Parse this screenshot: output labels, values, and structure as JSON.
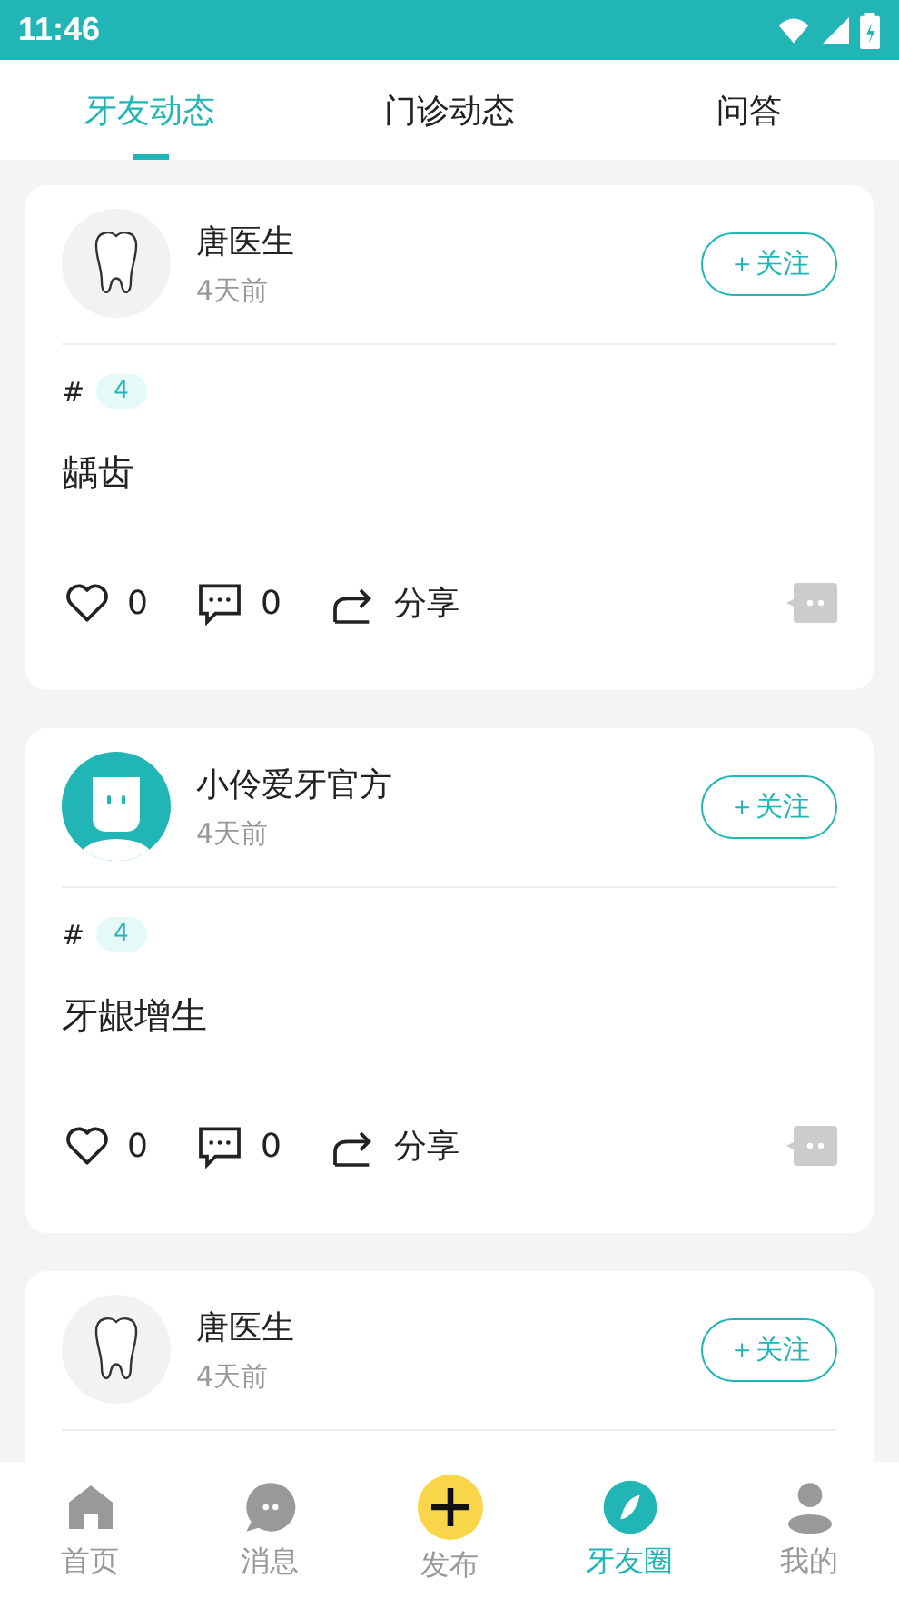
{
  "status_bar": {
    "time": "11:46"
  },
  "tabs": [
    {
      "label": "牙友动态",
      "selected": true
    },
    {
      "label": "门诊动态",
      "selected": false
    },
    {
      "label": "问答",
      "selected": false
    }
  ],
  "posts": [
    {
      "avatar": {
        "kind": "tooth"
      },
      "author": "唐医生",
      "time": "4天前",
      "follow": "＋关注",
      "hash": "#",
      "tag": "4",
      "text": "龋齿",
      "likes": "0",
      "comments": "0",
      "share": "分享"
    },
    {
      "avatar": {
        "kind": "mascot"
      },
      "author": "小伶爱牙官方",
      "time": "4天前",
      "follow": "＋关注",
      "hash": "#",
      "tag": "4",
      "text": "牙龈增生",
      "likes": "0",
      "comments": "0",
      "share": "分享"
    },
    {
      "avatar": {
        "kind": "tooth"
      },
      "author": "唐医生",
      "time": "4天前",
      "follow": "＋关注"
    }
  ],
  "nav": [
    {
      "kind": "home",
      "label": "首页",
      "selected": false
    },
    {
      "kind": "message",
      "label": "消息",
      "selected": false
    },
    {
      "kind": "publish",
      "label": "发布",
      "selected": false
    },
    {
      "kind": "circle",
      "label": "牙友圈",
      "selected": true
    },
    {
      "kind": "profile",
      "label": "我的",
      "selected": false
    }
  ]
}
